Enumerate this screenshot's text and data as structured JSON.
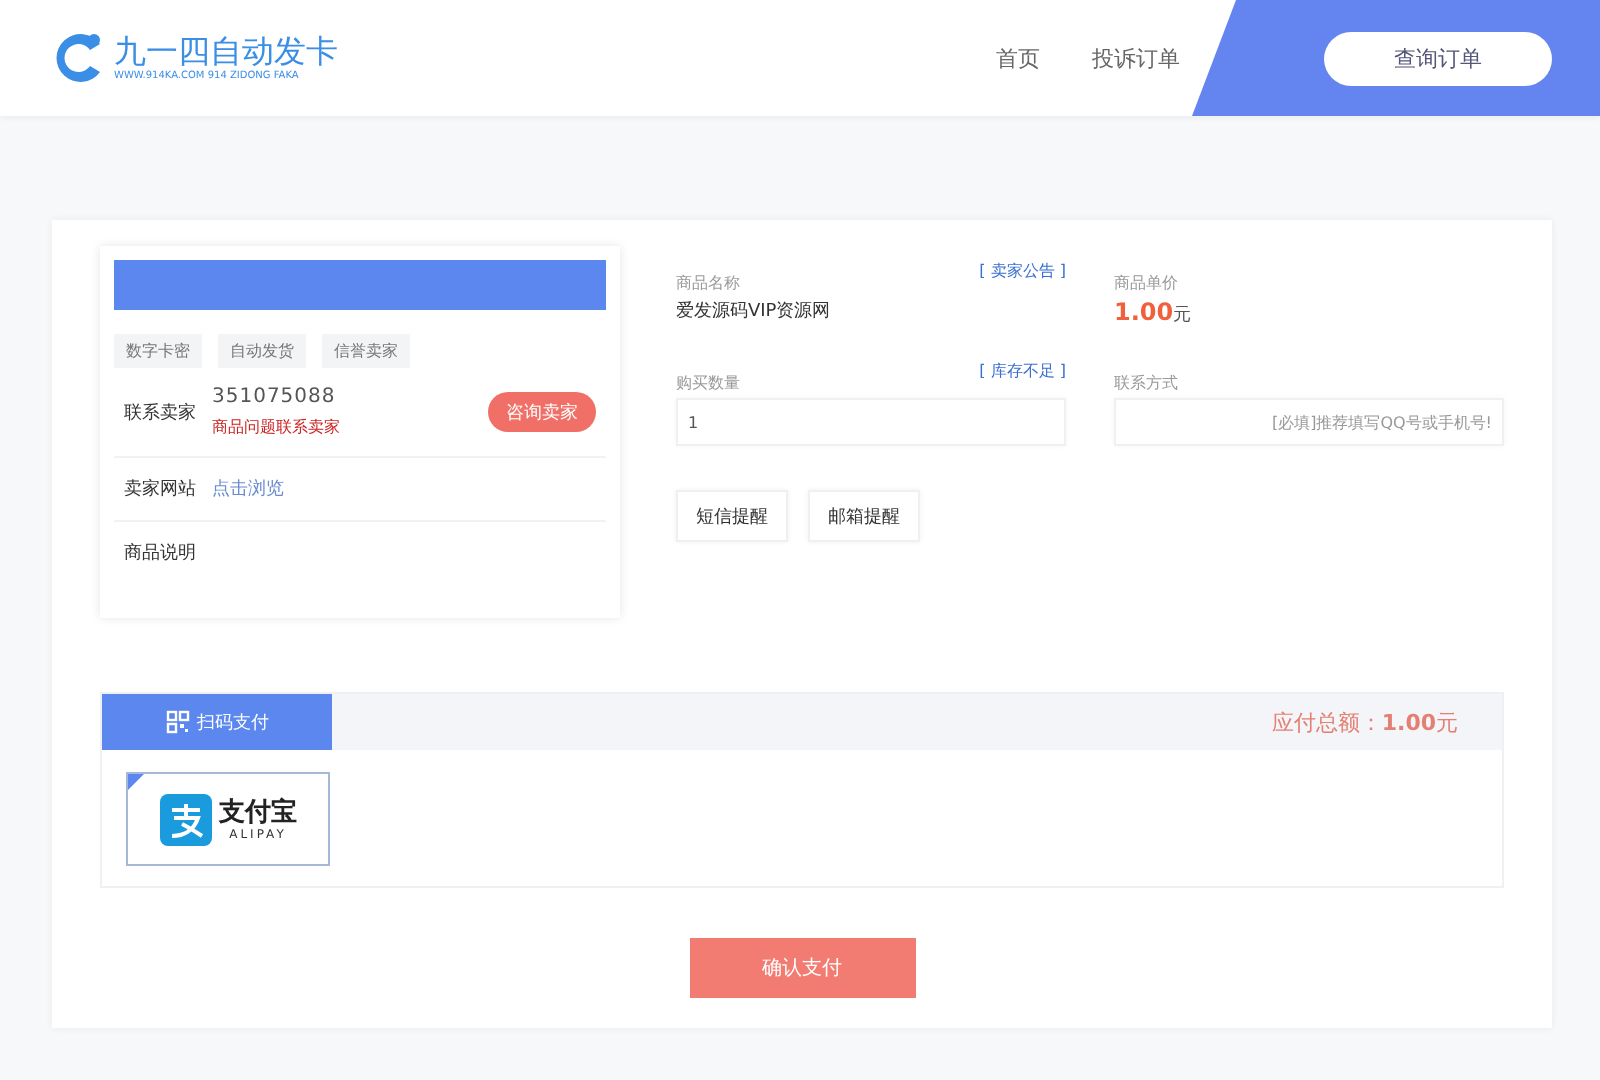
{
  "header": {
    "logo_title": "九一四自动发卡",
    "logo_subtitle": "WWW.914KA.COM 914 ZIDONG FAKA",
    "nav": [
      {
        "label": "首页"
      },
      {
        "label": "投诉订单"
      }
    ],
    "query_button": "查询订单"
  },
  "seller": {
    "tags": [
      "数字卡密",
      "自动发货",
      "信誉卖家"
    ],
    "contact_label": "联系卖家",
    "contact_value": "351075088",
    "contact_note": "商品问题联系卖家",
    "consult_button": "咨询卖家",
    "website_label": "卖家网站",
    "website_link": "点击浏览",
    "description_label": "商品说明"
  },
  "product": {
    "name_label": "商品名称",
    "announcement_link": "[ 卖家公告 ]",
    "name_value": "爱发源码VIP资源网",
    "price_label": "商品单价",
    "price_value": "1.00",
    "price_unit": "元",
    "quantity_label": "购买数量",
    "stock_link": "[ 库存不足 ]",
    "quantity_value": "1",
    "contact_label": "联系方式",
    "contact_placeholder": "[必填]推荐填写QQ号或手机号!",
    "reminder_buttons": [
      "短信提醒",
      "邮箱提醒"
    ]
  },
  "payment": {
    "tab": {
      "label": "扫码支付",
      "selected": true
    },
    "total": "应付总额：**1.00**元",
    "methods": [
      {
        "name": "支付宝",
        "sub": "ALIPAY",
        "selected": true
      }
    ]
  },
  "confirm_button": "确认支付"
}
